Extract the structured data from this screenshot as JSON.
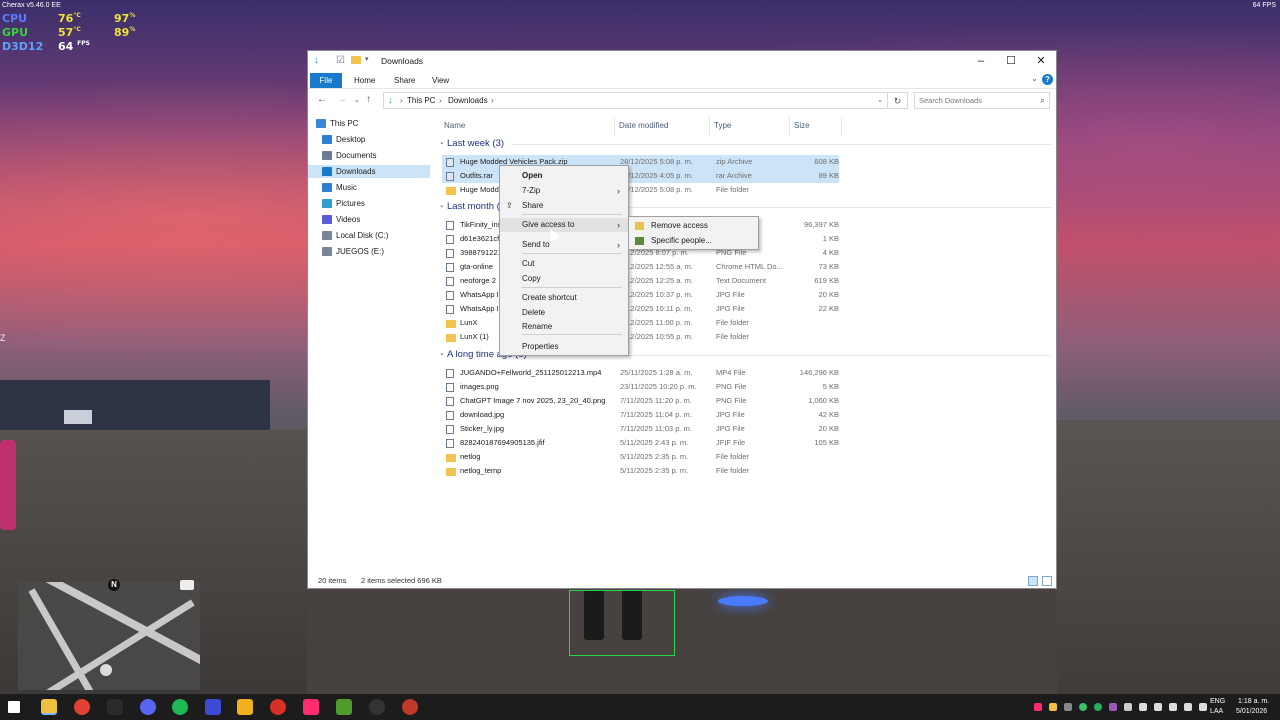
{
  "overlay": {
    "title": "Cherax v5.46.0 EE",
    "fps_top": "64 FPS",
    "cpu": {
      "label": "CPU",
      "temp": "76",
      "temp_unit": "°C",
      "load": "97",
      "load_unit": "%"
    },
    "gpu": {
      "label": "GPU",
      "temp": "57",
      "temp_unit": "°C",
      "load": "89",
      "load_unit": "%"
    },
    "d3d": {
      "label": "D3D12",
      "fps": "64",
      "fps_unit": "FPS"
    },
    "side_mark": "Z",
    "minimap_north": "N"
  },
  "window": {
    "title": "Downloads",
    "ribbon_tabs": [
      "File",
      "Home",
      "Share",
      "View"
    ],
    "address": {
      "root": "This PC",
      "sep": "›",
      "current": "Downloads"
    },
    "search_placeholder": "Search Downloads"
  },
  "nav_pane": [
    {
      "label": "This PC",
      "icon": "computer-icon",
      "selected": false
    },
    {
      "label": "Desktop",
      "icon": "desktop-icon",
      "selected": false
    },
    {
      "label": "Documents",
      "icon": "documents-icon",
      "selected": false
    },
    {
      "label": "Downloads",
      "icon": "downloads-icon",
      "selected": true
    },
    {
      "label": "Music",
      "icon": "music-icon",
      "selected": false
    },
    {
      "label": "Pictures",
      "icon": "pictures-icon",
      "selected": false
    },
    {
      "label": "Videos",
      "icon": "videos-icon",
      "selected": false
    },
    {
      "label": "Local Disk (C:)",
      "icon": "drive-icon",
      "selected": false
    },
    {
      "label": "JUEGOS (E:)",
      "icon": "drive-icon",
      "selected": false
    }
  ],
  "columns": {
    "name": "Name",
    "date": "Date modified",
    "type": "Type",
    "size": "Size"
  },
  "groups": [
    {
      "header": "Last week (3)",
      "rows": [
        {
          "name": "Huge Modded Vehicles Pack.zip",
          "date": "28/12/2025 5:08 p. m.",
          "type": "zip Archive",
          "size": "608 KB",
          "kind": "zip",
          "selected": true
        },
        {
          "name": "Outfits.rar",
          "date": "28/12/2025 4:05 p. m.",
          "type": "rar Archive",
          "size": "89 KB",
          "kind": "zip",
          "selected": true
        },
        {
          "name": "Huge Modded Vehicles Pack",
          "date": "28/12/2025 5:08 p. m.",
          "type": "File folder",
          "size": "",
          "kind": "folder",
          "selected": false
        }
      ]
    },
    {
      "header": "Last month (9)",
      "rows": [
        {
          "name": "TikFinity_installer.exe",
          "date": "",
          "type": "",
          "size": "96,397 KB",
          "kind": "file",
          "selected": false
        },
        {
          "name": "d61e3621cf",
          "date": "",
          "type": "",
          "size": "1 KB",
          "kind": "file",
          "selected": false
        },
        {
          "name": "3988791221",
          "date": "1/12/2025 8:07 p. m.",
          "type": "PNG File",
          "size": "4 KB",
          "kind": "file",
          "selected": false
        },
        {
          "name": "gta-online",
          "date": "1/12/2025 12:55 a. m.",
          "type": "Chrome HTML Do...",
          "size": "73 KB",
          "kind": "file",
          "selected": false
        },
        {
          "name": "neoforge 2",
          "date": "1/12/2025 12:25 a. m.",
          "type": "Text Document",
          "size": "619 KB",
          "kind": "file",
          "selected": false
        },
        {
          "name": "WhatsApp Image",
          "date": "1/12/2025 10:37 p. m.",
          "type": "JPG File",
          "size": "20 KB",
          "kind": "file",
          "selected": false
        },
        {
          "name": "WhatsApp Image",
          "date": "1/12/2025 10:11 p. m.",
          "type": "JPG File",
          "size": "22 KB",
          "kind": "file",
          "selected": false
        },
        {
          "name": "LunX",
          "date": "1/12/2025 11:00 p. m.",
          "type": "File folder",
          "size": "",
          "kind": "folder",
          "selected": false
        },
        {
          "name": "LunX (1)",
          "date": "1/12/2025 10:55 p. m.",
          "type": "File folder",
          "size": "",
          "kind": "folder",
          "selected": false
        }
      ]
    },
    {
      "header": "A long time ago (8)",
      "rows": [
        {
          "name": "JUGANDO+Fellworld_251125012213.mp4",
          "date": "25/11/2025 1:28 a. m.",
          "type": "MP4 File",
          "size": "146,296 KB",
          "kind": "file",
          "selected": false
        },
        {
          "name": "images.png",
          "date": "23/11/2025 10:20 p. m.",
          "type": "PNG File",
          "size": "5 KB",
          "kind": "file",
          "selected": false
        },
        {
          "name": "ChatGPT Image 7 nov 2025, 23_20_40.png",
          "date": "7/11/2025 11:20 p. m.",
          "type": "PNG File",
          "size": "1,060 KB",
          "kind": "file",
          "selected": false
        },
        {
          "name": "download.jpg",
          "date": "7/11/2025 11:04 p. m.",
          "type": "JPG File",
          "size": "42 KB",
          "kind": "file",
          "selected": false
        },
        {
          "name": "Sticker_ly.jpg",
          "date": "7/11/2025 11:03 p. m.",
          "type": "JPG File",
          "size": "20 KB",
          "kind": "file",
          "selected": false
        },
        {
          "name": "828240187694905135.jfif",
          "date": "5/11/2025 2:43 p. m.",
          "type": "JFIF File",
          "size": "105 KB",
          "kind": "file",
          "selected": false
        },
        {
          "name": "netlog",
          "date": "5/11/2025 2:35 p. m.",
          "type": "File folder",
          "size": "",
          "kind": "folder",
          "selected": false
        },
        {
          "name": "netlog_temp",
          "date": "5/11/2025 2:35 p. m.",
          "type": "File folder",
          "size": "",
          "kind": "folder",
          "selected": false
        }
      ]
    }
  ],
  "context_menu": [
    {
      "label": "Open",
      "bold": true,
      "submenu": false
    },
    {
      "label": "7-Zip",
      "submenu": true
    },
    {
      "label": "Share",
      "submenu": false,
      "icon": "share-icon"
    },
    {
      "label": "Give access to",
      "submenu": true,
      "highlight": true
    },
    {
      "label": "Send to",
      "submenu": true
    },
    {
      "label": "Cut"
    },
    {
      "label": "Copy"
    },
    {
      "label": "Create shortcut"
    },
    {
      "label": "Delete"
    },
    {
      "label": "Rename"
    },
    {
      "label": "Properties"
    }
  ],
  "submenu": [
    {
      "label": "Remove access",
      "icon": "lock-icon"
    },
    {
      "label": "Specific people...",
      "icon": "people-icon"
    }
  ],
  "status": {
    "items": "20 items",
    "selected": "2 items selected  696 KB"
  },
  "taskbar": {
    "apps": [
      "start-icon",
      "file-explorer-icon",
      "chrome-icon",
      "epic-games-icon",
      "discord-icon",
      "spotify-icon",
      "vscode-icon",
      "rockstar-icon",
      "chrome-profile-icon",
      "tiktok-icon",
      "vantage-icon",
      "github-icon",
      "chrome-alt-icon"
    ],
    "lang_top": "ENG",
    "lang_bottom": "LAA",
    "time": "1:18 a. m.",
    "date": "5/01/2026"
  }
}
